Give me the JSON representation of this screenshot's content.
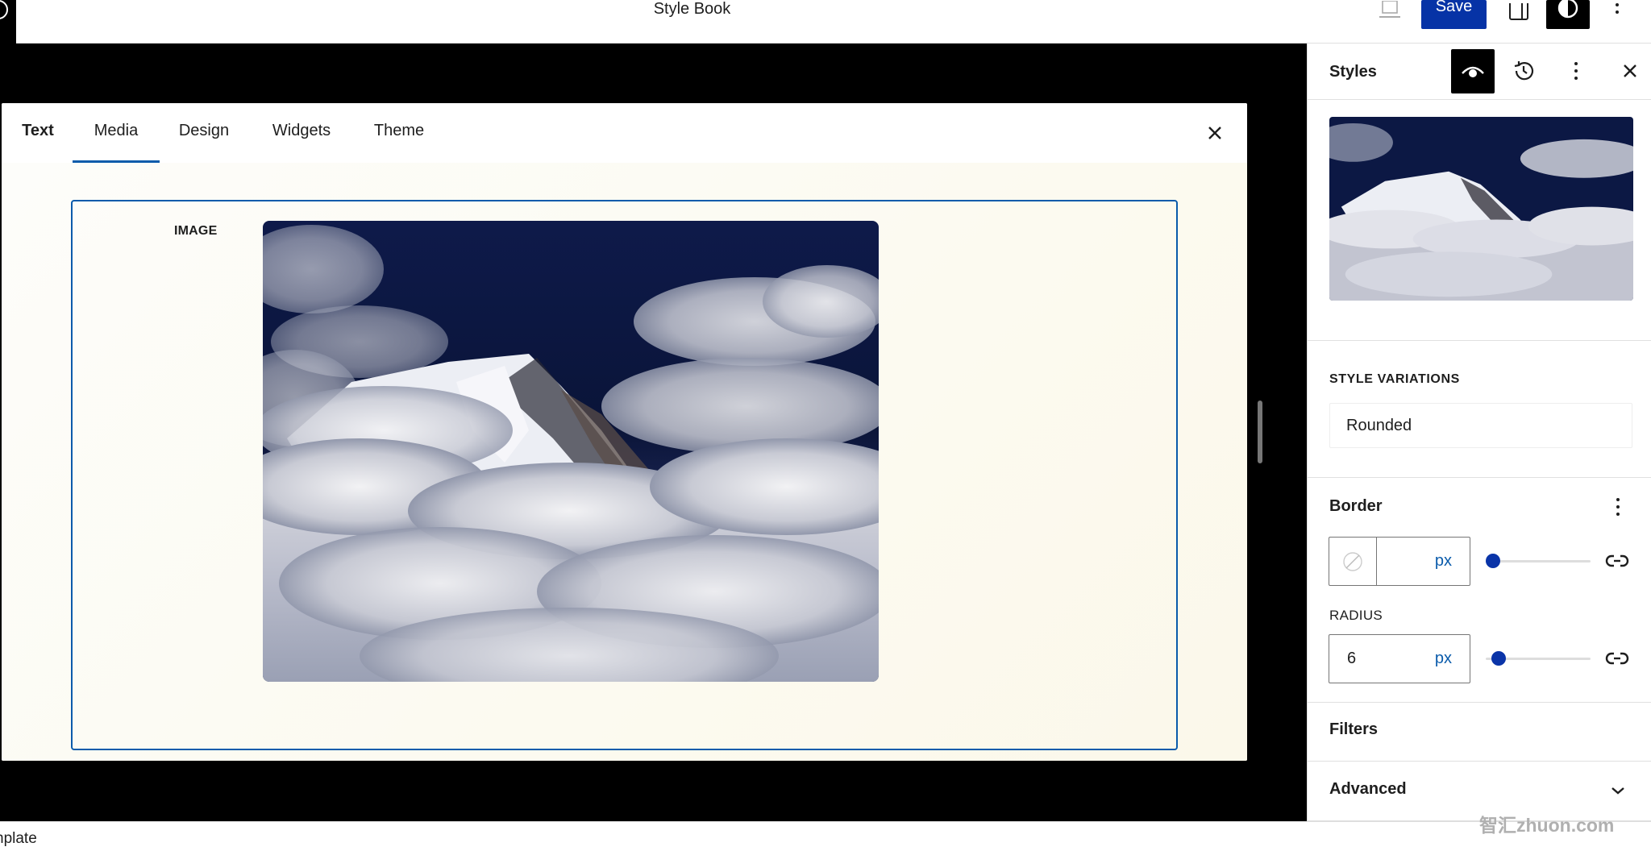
{
  "topbar": {
    "document_title": "Style Book",
    "save_label": "Save",
    "icons": {
      "logo": "wordpress-logo-icon",
      "preview": "laptop-icon",
      "sidebar_toggle": "sidebar-icon",
      "styles_toggle": "half-circle-contrast-icon",
      "options": "vertical-ellipsis-icon"
    }
  },
  "style_book": {
    "tabs": [
      {
        "label": "Text",
        "active": false
      },
      {
        "label": "Media",
        "active": true
      },
      {
        "label": "Design",
        "active": false
      },
      {
        "label": "Widgets",
        "active": false
      },
      {
        "label": "Theme",
        "active": false
      }
    ],
    "close_icon": "close-icon",
    "example": {
      "label": "IMAGE",
      "image_alt": "Aerial view of a snow-covered mountain peak rising above clouds"
    },
    "accent_color": "#0a5bab"
  },
  "footer": {
    "text": "nplate"
  },
  "sidebar": {
    "title": "Styles",
    "header_icons": {
      "preview": "eye-icon",
      "revisions": "history-icon",
      "more": "vertical-ellipsis-icon",
      "close": "close-icon"
    },
    "style_variations": {
      "label": "STYLE VARIATIONS",
      "selected": "Rounded"
    },
    "border": {
      "title": "Border",
      "width_value": "",
      "width_unit": "px",
      "width_slider_value": 0,
      "color_swatch": "no-color",
      "radius_label": "RADIUS",
      "radius_value": "6",
      "radius_unit": "px",
      "radius_slider_fraction": 0.06
    },
    "filters": {
      "title": "Filters"
    },
    "advanced": {
      "title": "Advanced",
      "expanded": false
    }
  },
  "colors": {
    "primary": "#0633a6",
    "slider_thumb": "#0a34a8",
    "selection_outline": "#0a5bab"
  },
  "watermark": "智汇zhuon.com"
}
